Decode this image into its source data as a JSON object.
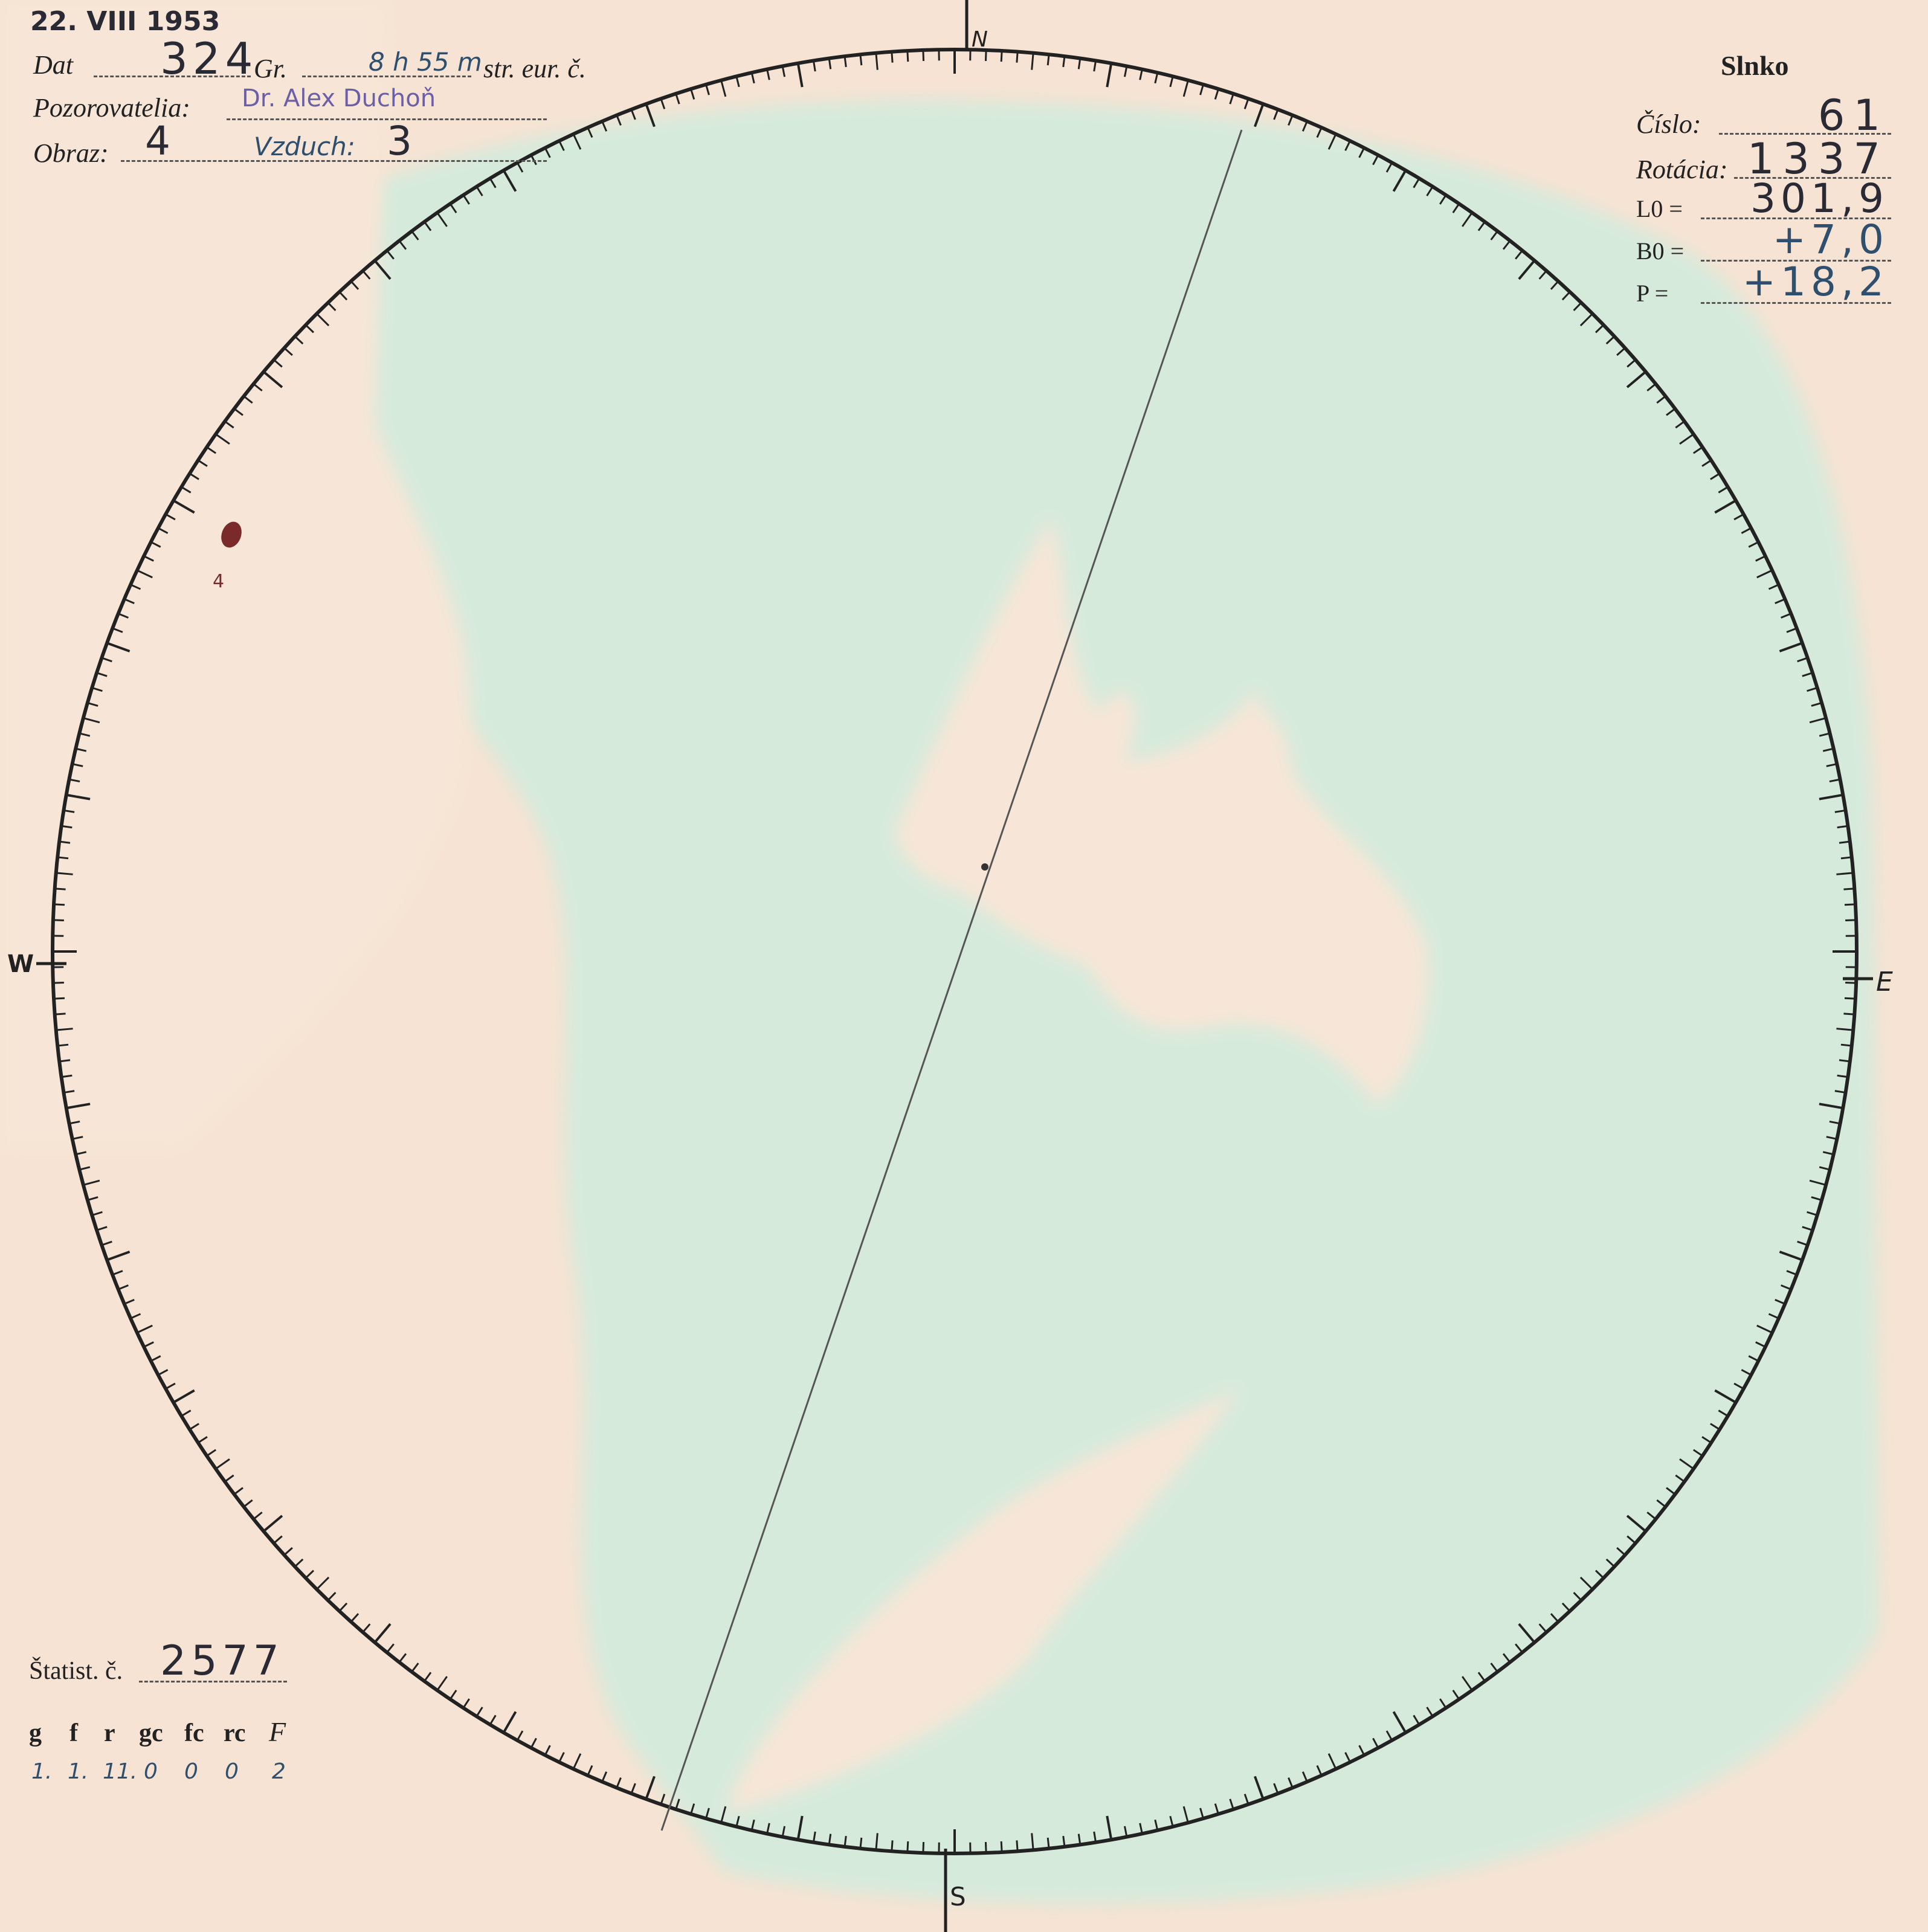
{
  "header": {
    "date_stamp": "22. VIII 1953",
    "dat_label": "Dat",
    "dat_value": "324",
    "gr_label": "Gr.",
    "time_value": "8 h 55 m",
    "time_suffix": "str. eur. č.",
    "observers_label": "Pozorovatelia:",
    "observers_value": "Dr. Alex Duchoň",
    "image_label": "Obraz:",
    "image_value": "4",
    "air_label": "Vzduch:",
    "air_value": "3"
  },
  "sun_panel": {
    "title": "Slnko",
    "rows": [
      {
        "label": "Číslo:",
        "value": "61"
      },
      {
        "label": "Rotácia:",
        "value": "1337"
      },
      {
        "label": "L0 =",
        "value": "301,9"
      },
      {
        "label": "B0 =",
        "value": "+7,0"
      },
      {
        "label": "P =",
        "value": "+18,2"
      }
    ]
  },
  "directions": {
    "north": "N",
    "south": "S",
    "west": "W",
    "east": "E"
  },
  "sunspot": {
    "group_number": "4"
  },
  "statistics": {
    "label": "Štatist. č.",
    "value": "2577",
    "columns": [
      "g",
      "f",
      "r",
      "gc",
      "fc",
      "rc",
      "F"
    ],
    "values": [
      "1.",
      "1.",
      "11.",
      "0",
      "0",
      "0",
      "2"
    ]
  },
  "colors": {
    "paper": "#f6e3d3",
    "stain": "#d3ebdd",
    "ink": "#222222",
    "stamp": "#6a5fa8",
    "spot": "#7a2a2a"
  }
}
